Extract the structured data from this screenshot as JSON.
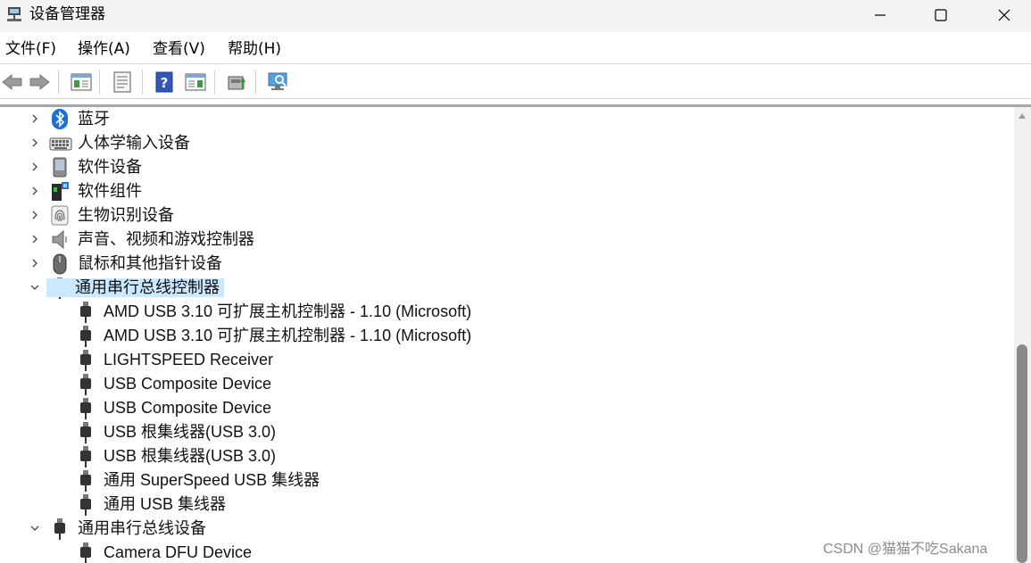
{
  "window": {
    "title": "设备管理器",
    "controls": {
      "minimize": "minimize",
      "maximize": "maximize",
      "close": "close"
    }
  },
  "menu": [
    "文件(F)",
    "操作(A)",
    "查看(V)",
    "帮助(H)"
  ],
  "toolbar": {
    "buttons": [
      "back-arrow-icon",
      "forward-arrow-icon",
      "show-hide-tree-icon",
      "properties-icon",
      "help-icon",
      "action-pane-icon",
      "update-driver-icon",
      "scan-hardware-icon"
    ]
  },
  "tree": {
    "categories": [
      {
        "label": "蓝牙",
        "icon": "bluetooth-icon",
        "expanded": false
      },
      {
        "label": "人体学输入设备",
        "icon": "keyboard-icon",
        "expanded": false
      },
      {
        "label": "软件设备",
        "icon": "software-device-icon",
        "expanded": false
      },
      {
        "label": "软件组件",
        "icon": "software-component-icon",
        "expanded": false
      },
      {
        "label": "生物识别设备",
        "icon": "fingerprint-icon",
        "expanded": false
      },
      {
        "label": "声音、视频和游戏控制器",
        "icon": "speaker-icon",
        "expanded": false
      },
      {
        "label": "鼠标和其他指针设备",
        "icon": "mouse-icon",
        "expanded": false
      },
      {
        "label": "通用串行总线控制器",
        "icon": "usb-icon",
        "expanded": true,
        "selected": true,
        "children": [
          "AMD USB 3.10 可扩展主机控制器 - 1.10 (Microsoft)",
          "AMD USB 3.10 可扩展主机控制器 - 1.10 (Microsoft)",
          "LIGHTSPEED Receiver",
          "USB Composite Device",
          "USB Composite Device",
          "USB 根集线器(USB 3.0)",
          "USB 根集线器(USB 3.0)",
          "通用 SuperSpeed USB 集线器",
          "通用 USB 集线器"
        ]
      },
      {
        "label": "通用串行总线设备",
        "icon": "usb-icon",
        "expanded": true,
        "children": [
          "Camera DFU Device"
        ]
      }
    ]
  },
  "watermark": "CSDN @猫猫不吃Sakana",
  "colors": {
    "selection": "#cce8ff",
    "titlebar": "#f3f3f3",
    "scroll_thumb": "#8a8a8a"
  }
}
